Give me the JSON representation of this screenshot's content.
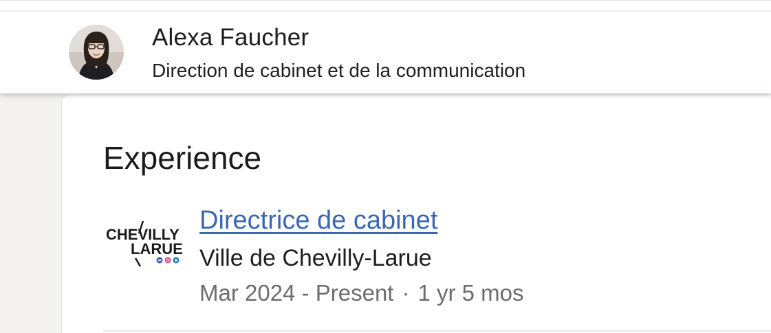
{
  "profile": {
    "name": "Alexa Faucher",
    "headline": "Direction de cabinet et de la communication"
  },
  "experience": {
    "section_title": "Experience",
    "items": [
      {
        "title": "Directrice de cabinet",
        "company": "Ville de Chevilly-Larue",
        "logo_text_line1": "CHEVILLY",
        "logo_text_line2": "LARUE",
        "start": "Mar 2024 - Present",
        "separator": "·",
        "duration": "1 yr 5 mos"
      }
    ]
  },
  "colors": {
    "link": "#3a67b1",
    "secondary_text": "#6c6c6c",
    "page_background": "#f4f2ee"
  },
  "icons": [
    "profile-avatar",
    "chevilly-larue-logo",
    "facebook-icon",
    "instagram-icon",
    "linkedin-icon"
  ]
}
